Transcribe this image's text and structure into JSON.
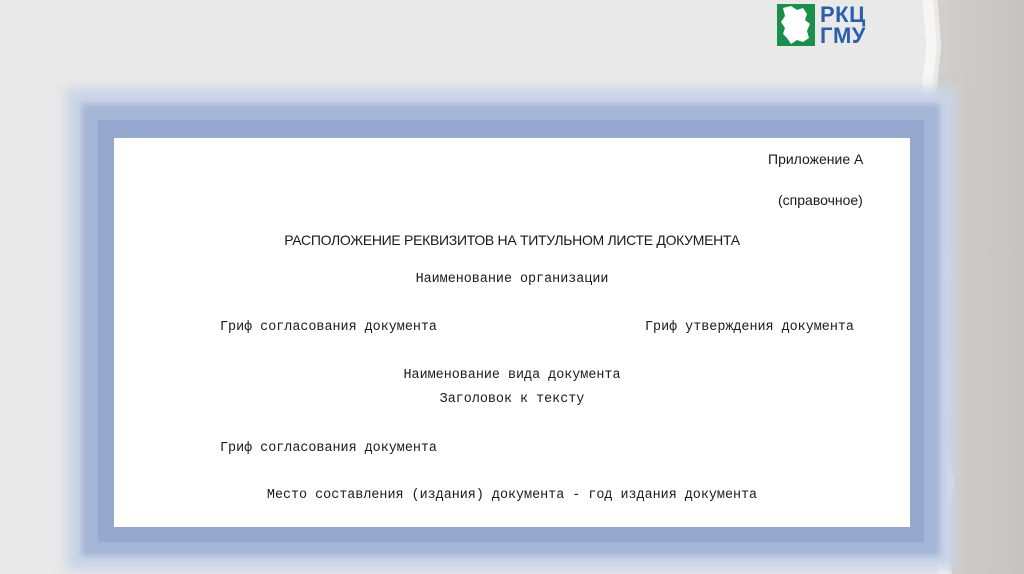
{
  "logo": {
    "line1": "РКЦ",
    "line2": "ГМУ",
    "mark_color": "#1a8f4c",
    "text_color": "#2b5faa"
  },
  "document": {
    "appendix": "Приложение А",
    "appendix_type": "(справочное)",
    "title": "РАСПОЛОЖЕНИЕ РЕКВИЗИТОВ НА ТИТУЛЬНОМ ЛИСТЕ ДОКУМЕНТА",
    "org_name": "Наименование организации",
    "approval_left": "Гриф согласования документа",
    "approval_right": "Гриф утверждения документа",
    "doc_type": "Наименование вида документа",
    "doc_heading": "Заголовок к тексту",
    "approval_bottom": "Гриф согласования документа",
    "place_year": "Место составления (издания) документа - год издания документа"
  },
  "colors": {
    "frame": "#94a8d0",
    "background": "#e9e9e9"
  }
}
